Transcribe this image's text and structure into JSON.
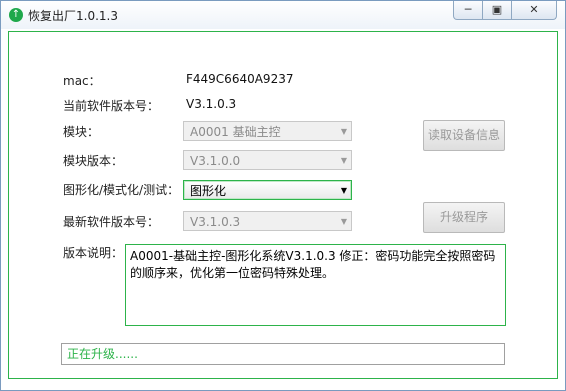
{
  "window": {
    "title": "恢复出厂1.0.1.3",
    "minimize_glyph": "─",
    "restore_glyph": "▣",
    "close_glyph": "✕"
  },
  "form": {
    "mac_label": "mac：",
    "mac_value": "F449C6640A9237",
    "current_version_label": "当前软件版本号：",
    "current_version_value": "V3.1.0.3",
    "module_label": "模块：",
    "module_value": "A0001 基础主控",
    "module_version_label": "模块版本：",
    "module_version_value": "V3.1.0.0",
    "mode_label": "图形化/模式化/测试：",
    "mode_value": "图形化",
    "latest_version_label": "最新软件版本号：",
    "latest_version_value": "V3.1.0.3",
    "notes_label": "版本说明：",
    "notes_text": "A0001-基础主控-图形化系统V3.1.0.3  修正：密码功能完全按照密码的顺序来，优化第一位密码特殊处理。"
  },
  "buttons": {
    "read_device": "读取设备信息",
    "upgrade": "升级程序"
  },
  "status": {
    "text": "正在升级......"
  },
  "colors": {
    "accent_green": "#2db34a",
    "titlebar_border": "#7a9bbf"
  }
}
